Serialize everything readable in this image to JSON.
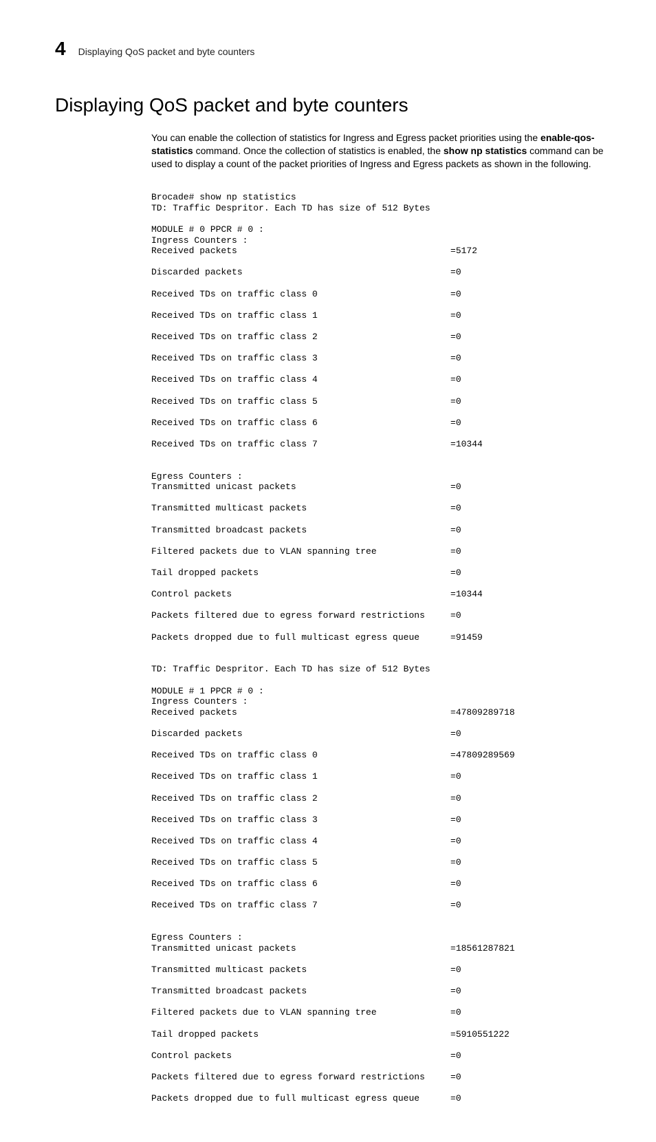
{
  "header": {
    "chapter": "4",
    "section": "Displaying QoS packet and byte counters"
  },
  "title": "Displaying QoS packet and byte counters",
  "intro": {
    "p1a": "You can enable the collection of statistics for Ingress and Egress packet priorities using the ",
    "cmd1": "enable-qos-statistics",
    "p1b": " command. Once the collection of statistics is enabled, the ",
    "cmd2": "show np statistics",
    "p1c": " command can be used to display a count of the packet priorities of Ingress and Egress packets as shown in the following."
  },
  "code": {
    "l1": "Brocade# show np statistics",
    "l2": "TD: Traffic Despritor. Each TD has size of 512 Bytes",
    "l3": "MODULE # 0 PPCR # 0 :",
    "l4": "Ingress Counters :",
    "m0i": [
      {
        "k": "Received packets",
        "v": "5172"
      },
      {
        "k": "Discarded packets",
        "v": "0"
      },
      {
        "k": "Received TDs on traffic class 0",
        "v": "0"
      },
      {
        "k": "Received TDs on traffic class 1",
        "v": "0"
      },
      {
        "k": "Received TDs on traffic class 2",
        "v": "0"
      },
      {
        "k": "Received TDs on traffic class 3",
        "v": "0"
      },
      {
        "k": "Received TDs on traffic class 4",
        "v": "0"
      },
      {
        "k": "Received TDs on traffic class 5",
        "v": "0"
      },
      {
        "k": "Received TDs on traffic class 6",
        "v": "0"
      },
      {
        "k": "Received TDs on traffic class 7",
        "v": "10344"
      }
    ],
    "l5": "Egress Counters :",
    "m0e": [
      {
        "k": "Transmitted unicast packets",
        "v": "0"
      },
      {
        "k": "Transmitted multicast packets",
        "v": "0"
      },
      {
        "k": "Transmitted broadcast packets",
        "v": "0"
      },
      {
        "k": "Filtered packets due to VLAN spanning tree",
        "v": "0"
      },
      {
        "k": "Tail dropped packets",
        "v": "0"
      },
      {
        "k": "Control packets",
        "v": "10344"
      },
      {
        "k": "Packets filtered due to egress forward restrictions",
        "v": "0"
      },
      {
        "k": "Packets dropped due to full multicast egress queue",
        "v": "91459"
      }
    ],
    "l6": "TD: Traffic Despritor. Each TD has size of 512 Bytes",
    "l7": "MODULE # 1 PPCR # 0 :",
    "l8": "Ingress Counters :",
    "m1i": [
      {
        "k": "Received packets",
        "v": "47809289718"
      },
      {
        "k": "Discarded packets",
        "v": "0"
      },
      {
        "k": "Received TDs on traffic class 0",
        "v": "47809289569"
      },
      {
        "k": "Received TDs on traffic class 1",
        "v": "0"
      },
      {
        "k": "Received TDs on traffic class 2",
        "v": "0"
      },
      {
        "k": "Received TDs on traffic class 3",
        "v": "0"
      },
      {
        "k": "Received TDs on traffic class 4",
        "v": "0"
      },
      {
        "k": "Received TDs on traffic class 5",
        "v": "0"
      },
      {
        "k": "Received TDs on traffic class 6",
        "v": "0"
      },
      {
        "k": "Received TDs on traffic class 7",
        "v": "0"
      }
    ],
    "l9": "Egress Counters :",
    "m1e": [
      {
        "k": "Transmitted unicast packets",
        "v": "18561287821"
      },
      {
        "k": "Transmitted multicast packets",
        "v": "0"
      },
      {
        "k": "Transmitted broadcast packets",
        "v": "0"
      },
      {
        "k": "Filtered packets due to VLAN spanning tree",
        "v": "0"
      },
      {
        "k": "Tail dropped packets",
        "v": "5910551222"
      },
      {
        "k": "Control packets",
        "v": "0"
      },
      {
        "k": "Packets filtered due to egress forward restrictions",
        "v": "0"
      },
      {
        "k": "Packets dropped due to full multicast egress queue",
        "v": "0"
      }
    ]
  }
}
